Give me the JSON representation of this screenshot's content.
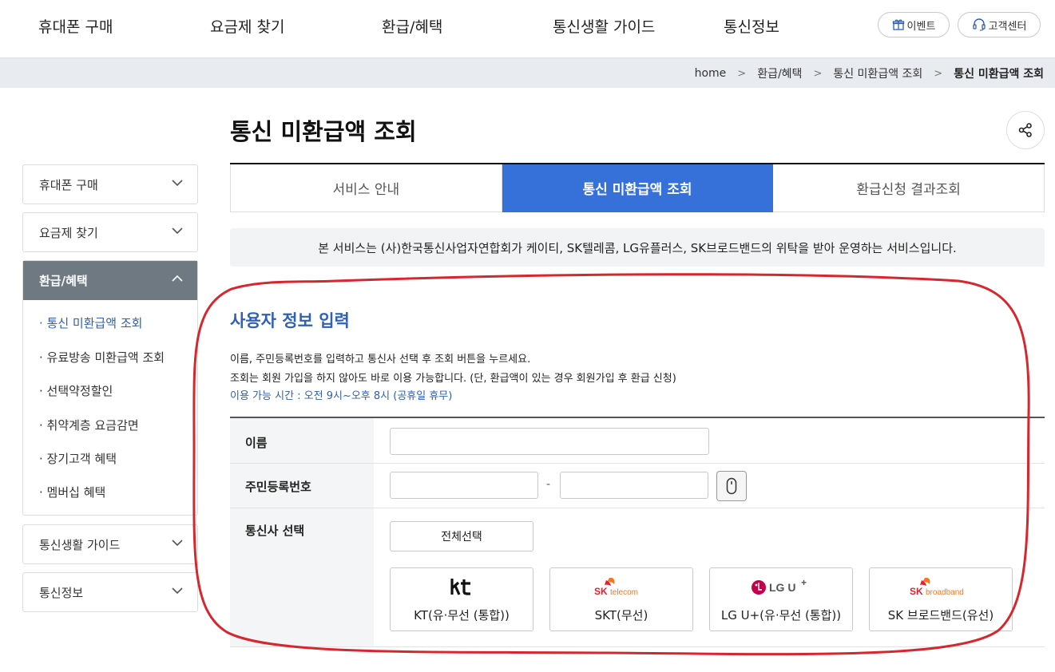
{
  "header": {
    "nav": [
      "휴대폰 구매",
      "요금제 찾기",
      "환급/혜택",
      "통신생활 가이드",
      "통신정보"
    ],
    "event_label": "이벤트",
    "support_label": "고객센터"
  },
  "breadcrumb": [
    "home",
    "환급/혜택",
    "통신 미환급액 조회",
    "통신 미환급액 조회"
  ],
  "sidebar": {
    "top_items": [
      "휴대폰 구매",
      "요금제 찾기"
    ],
    "open_section": {
      "label": "환급/혜택",
      "items": [
        "· 통신 미환급액 조회",
        "· 유료방송 미환급액 조회",
        "· 선택약정할인",
        "· 취약계층 요금감면",
        "· 장기고객 혜택",
        "· 멤버십 혜택"
      ]
    },
    "bottom_items": [
      "통신생활 가이드",
      "통신정보"
    ]
  },
  "page": {
    "title": "통신 미환급액 조회",
    "tabs": [
      "서비스 안내",
      "통신 미환급액 조회",
      "환급신청 결과조회"
    ],
    "active_tab": 1,
    "notice": "본 서비스는 (사)한국통신사업자연합회가 케이티, SK텔레콤, LG유플러스, SK브로드밴드의 위탁을 받아 운영하는 서비스입니다."
  },
  "user_info": {
    "title": "사용자 정보 입력",
    "desc1": "이름, 주민등록번호를 입력하고 통신사 선택 후 조회 버튼을 누르세요.",
    "desc2": "조회는 회원 가입을 하지 않아도 바로 이용 가능합니다. (단, 환급액이 있는 경우 회원가입 후 환급 신청)",
    "hours": "이용 가능 시간 : 오전 9시~오후 8시 (공휴일 휴무)"
  },
  "form": {
    "name_label": "이름",
    "name_value": "",
    "rrn_label": "주민등록번호",
    "rrn_front_value": "",
    "rrn_back_value": "",
    "rrn_separator": "-",
    "carrier_label": "통신사 선택",
    "select_all_label": "전체선택",
    "carriers": [
      {
        "name": "KT(유·무선 (통합))",
        "logo": "kt"
      },
      {
        "name": "SKT(무선)",
        "logo": "SK telecom"
      },
      {
        "name": "LG U+(유·무선 (통합))",
        "logo": "LG U+"
      },
      {
        "name": "SK 브로드밴드(유선)",
        "logo": "SK broadband"
      }
    ]
  },
  "colors": {
    "accent": "#3571d8",
    "title_blue": "#2f60b8",
    "sidebar_active": "#6e7982",
    "annotation_red": "#d7272e"
  }
}
